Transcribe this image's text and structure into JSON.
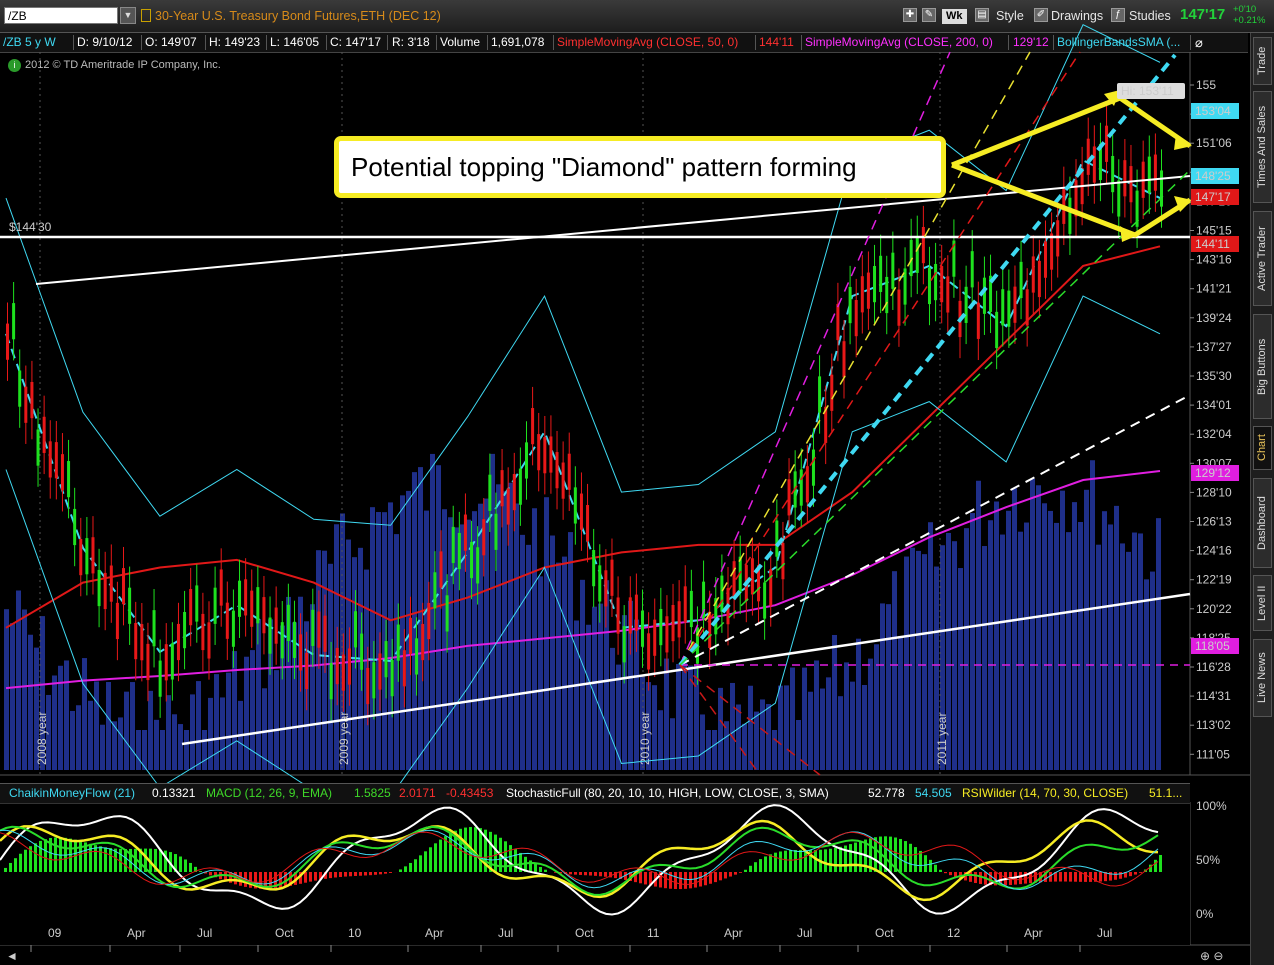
{
  "toolbar": {
    "symbol": "/ZB",
    "description": "30-Year U.S. Treasury Bond Futures,ETH (DEC 12)",
    "zoom_badge": "Wk",
    "style_label": "Style",
    "drawings_label": "Drawings",
    "studies_label": "Studies",
    "last_price": "147'17",
    "net_change": "+0'10",
    "pct_change": "+0.21%"
  },
  "info_bar": {
    "symbol_period": "/ZB 5 y W",
    "date": "D: 9/10/12",
    "open": "O: 149'07",
    "high": "H: 149'23",
    "low": "L: 146'05",
    "close": "C: 147'17",
    "range": "R: 3'18",
    "volume_label": "Volume",
    "volume_value": "1,691,078",
    "sma50_label": "SimpleMovingAvg (CLOSE, 50, 0)",
    "sma50_value": "144'11",
    "sma200_label": "SimpleMovingAvg (CLOSE, 200, 0)",
    "sma200_value": "129'12",
    "bb_label": "BollingerBandsSMA (..."
  },
  "copyright": "2012 © TD Ameritrade IP Company, Inc.",
  "callout": "Potential topping \"Diamond\" pattern forming",
  "hi_label": "Hi: 153'11",
  "level_label": "$144'30",
  "price_axis": [
    "155",
    "153'04",
    "151'06",
    "149'08",
    "147'10",
    "145'15",
    "143'16",
    "141'21",
    "139'24",
    "137'27",
    "135'30",
    "134'01",
    "132'04",
    "130'07",
    "128'10",
    "126'13",
    "124'16",
    "122'19",
    "120'22",
    "118'25",
    "116'28",
    "114'31",
    "113'02",
    "111'05"
  ],
  "price_badges": [
    {
      "text": "153'04",
      "color": "#3fd9f2"
    },
    {
      "text": "148'25",
      "color": "#3fd9f2"
    },
    {
      "text": "147'17",
      "color": "#e01818"
    },
    {
      "text": "144'11",
      "color": "#e01818"
    },
    {
      "text": "129'12",
      "color": "#e01ee0"
    },
    {
      "text": "118'05",
      "color": "#e01ee0"
    }
  ],
  "year_labels": [
    "2008 year",
    "2009 year",
    "2010 year",
    "2011 year"
  ],
  "time_axis": [
    "09",
    "Apr",
    "Jul",
    "Oct",
    "10",
    "Apr",
    "Jul",
    "Oct",
    "11",
    "Apr",
    "Jul",
    "Oct",
    "12",
    "Apr",
    "Jul"
  ],
  "lower_bar": {
    "cmf_label": "ChaikinMoneyFlow (21)",
    "cmf_value": "0.13321",
    "macd_label": "MACD (12, 26, 9, EMA)",
    "macd_v1": "1.5825",
    "macd_v2": "2.0171",
    "macd_v3": "-0.43453",
    "stoch_label": "StochasticFull (80, 20, 10, 10, HIGH, LOW, CLOSE, 3, SMA)",
    "stoch_v1": "52.778",
    "stoch_v2": "54.505",
    "rsi_label": "RSIWilder (14, 70, 30, CLOSE)",
    "rsi_value": "51.1..."
  },
  "lower_axis": [
    "100%",
    "50%",
    "0%"
  ],
  "sidebar_tabs": [
    "Trade",
    "Times And Sales",
    "Active Trader",
    "Big Buttons",
    "Chart",
    "Dashboard",
    "Level II",
    "Live News"
  ],
  "colors": {
    "up": "#1ee11e",
    "down": "#e81818",
    "bb": "#3fd9f2",
    "sma50": "#e01818",
    "sma200": "#e01ee0",
    "volume": "#1f2f8a",
    "accent": "#f6ec24"
  },
  "chart_data": {
    "type": "line",
    "title": "30-Year U.S. Treasury Bond Futures,ETH (DEC 12)",
    "x": [
      "2009-01",
      "2009-04",
      "2009-07",
      "2009-10",
      "2010-01",
      "2010-04",
      "2010-07",
      "2010-10",
      "2011-01",
      "2011-04",
      "2011-07",
      "2011-10",
      "2012-01",
      "2012-04",
      "2012-07",
      "2012-09"
    ],
    "series": [
      {
        "name": "close",
        "values": [
          138.5,
          124.3,
          117.4,
          120.5,
          117.2,
          116.8,
          124.0,
          132.0,
          119.0,
          119.5,
          123.0,
          141.0,
          143.0,
          139.0,
          150.0,
          147.5
        ]
      },
      {
        "name": "SimpleMovingAvg (CLOSE, 50, 0)",
        "values": [
          119.0,
          122.0,
          123.0,
          123.5,
          122.0,
          119.5,
          121.0,
          123.0,
          124.0,
          124.5,
          124.5,
          128.0,
          133.0,
          138.0,
          143.0,
          144.3
        ]
      },
      {
        "name": "SimpleMovingAvg (CLOSE, 200, 0)",
        "values": [
          115.0,
          115.5,
          115.8,
          116.2,
          116.5,
          117.0,
          117.8,
          118.3,
          118.8,
          119.5,
          120.5,
          122.5,
          125.0,
          127.0,
          128.8,
          129.4
        ]
      }
    ],
    "ylim": [
      110,
      157
    ]
  }
}
